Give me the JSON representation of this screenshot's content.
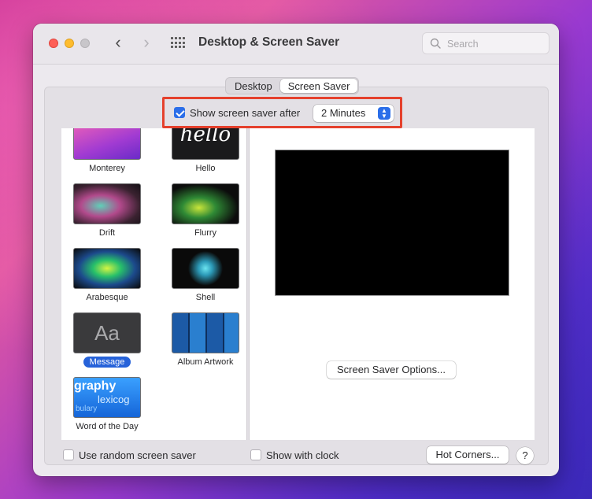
{
  "window": {
    "title": "Desktop & Screen Saver",
    "search_placeholder": "Search"
  },
  "tabs": [
    {
      "label": "Desktop",
      "active": false
    },
    {
      "label": "Screen Saver",
      "active": true
    }
  ],
  "show_after": {
    "label": "Show screen saver after",
    "checked": true,
    "value": "2 Minutes"
  },
  "savers": [
    {
      "label": "Monterey",
      "thumb_icon": "monterey-wallpaper"
    },
    {
      "label": "Hello",
      "thumb_text": "hello"
    },
    {
      "label": "Drift",
      "thumb_icon": "drift-pattern"
    },
    {
      "label": "Flurry",
      "thumb_icon": "flurry-pattern"
    },
    {
      "label": "Arabesque",
      "thumb_icon": "arabesque-pattern"
    },
    {
      "label": "Shell",
      "thumb_icon": "shell-pattern"
    },
    {
      "label": "Message",
      "thumb_text": "Aa",
      "selected": true
    },
    {
      "label": "Album Artwork",
      "thumb_icon": "album-artwork-grid"
    },
    {
      "label": "Word of the Day",
      "thumb_words": [
        "graphy",
        "lexicog",
        "bulary"
      ]
    }
  ],
  "options_button": "Screen Saver Options...",
  "random": {
    "label": "Use random screen saver",
    "checked": false
  },
  "clock": {
    "label": "Show with clock",
    "checked": false
  },
  "hot_corners_button": "Hot Corners...",
  "help_button": "?",
  "colors": {
    "accent": "#2b6ee9",
    "highlight_box": "#e5412d",
    "close": "#fe5f57",
    "minimize": "#febc2e"
  }
}
